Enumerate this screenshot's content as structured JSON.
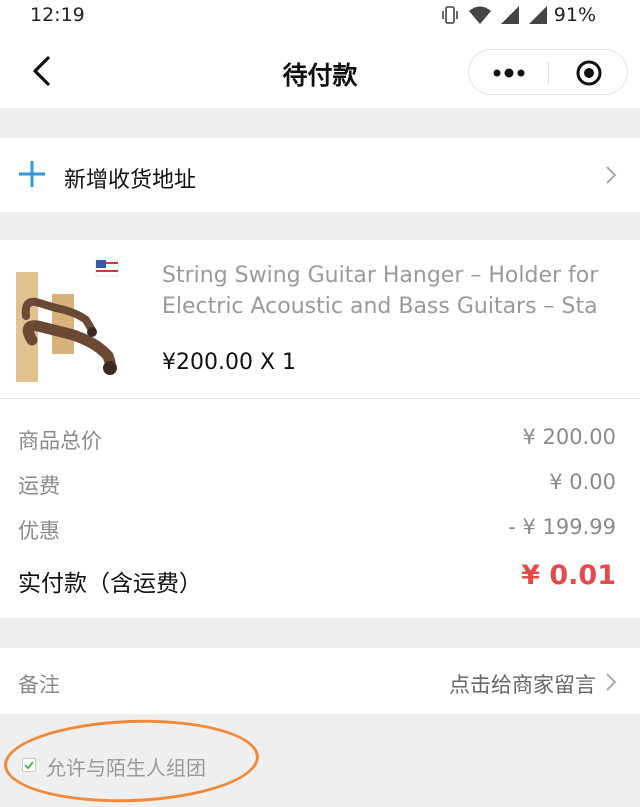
{
  "status_bar": {
    "time": "12:19",
    "battery": "91%"
  },
  "nav": {
    "title": "待付款"
  },
  "address": {
    "add_label": "新增收货地址"
  },
  "order": {
    "product_name": "String Swing Guitar Hanger – Holder for Electric Acoustic and Bass Guitars – Sta",
    "product_price": "¥200.00 X 1",
    "summary": [
      {
        "label": "商品总价",
        "value": "¥ 200.00"
      },
      {
        "label": "运费",
        "value": "¥ 0.00"
      },
      {
        "label": "优惠",
        "value": "- ¥ 199.99"
      }
    ],
    "total_label": "实付款（含运费）",
    "total_value": "¥ 0.01"
  },
  "remark": {
    "label": "备注",
    "action": "点击给商家留言"
  },
  "group": {
    "label": "允许与陌生人组团",
    "checked": true
  },
  "colors": {
    "accent_blue": "#2f9ad9",
    "price_red": "#e34b4b",
    "highlight_orange": "#f08a3a"
  },
  "icons": [
    "back-arrow-icon",
    "more-dots-icon",
    "close-target-icon",
    "plus-icon",
    "chevron-right-icon",
    "vibrate-icon",
    "wifi-icon",
    "signal-icon",
    "check-icon",
    "flag-icon"
  ]
}
